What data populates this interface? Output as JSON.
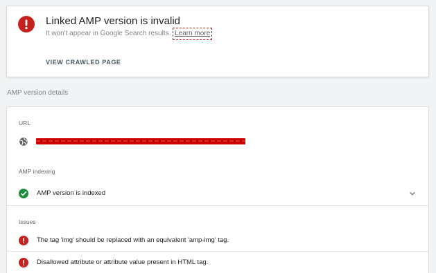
{
  "status_card": {
    "title": "Linked AMP version is invalid",
    "subtitle": "It won't appear in Google Search results.",
    "learn_more": "Learn more",
    "view_crawled_page": "VIEW CRAWLED PAGE"
  },
  "details": {
    "section_heading": "AMP version details",
    "url_label": "URL",
    "indexing_label": "AMP indexing",
    "indexing_status": "AMP version is indexed",
    "issues_label": "Issues",
    "issues": [
      "The tag 'img' should be replaced with an equivalent 'amp-img' tag.",
      "Disallowed attribute or attribute value present in HTML tag."
    ]
  },
  "colors": {
    "error_red": "#c5221f",
    "success_green": "#1e8e3e",
    "redaction": "#cc0000"
  },
  "icons": {
    "status": "error-icon",
    "url": "globe-icon",
    "indexing": "check-circle-icon",
    "expand": "chevron-down-icon",
    "issue": "error-icon"
  }
}
